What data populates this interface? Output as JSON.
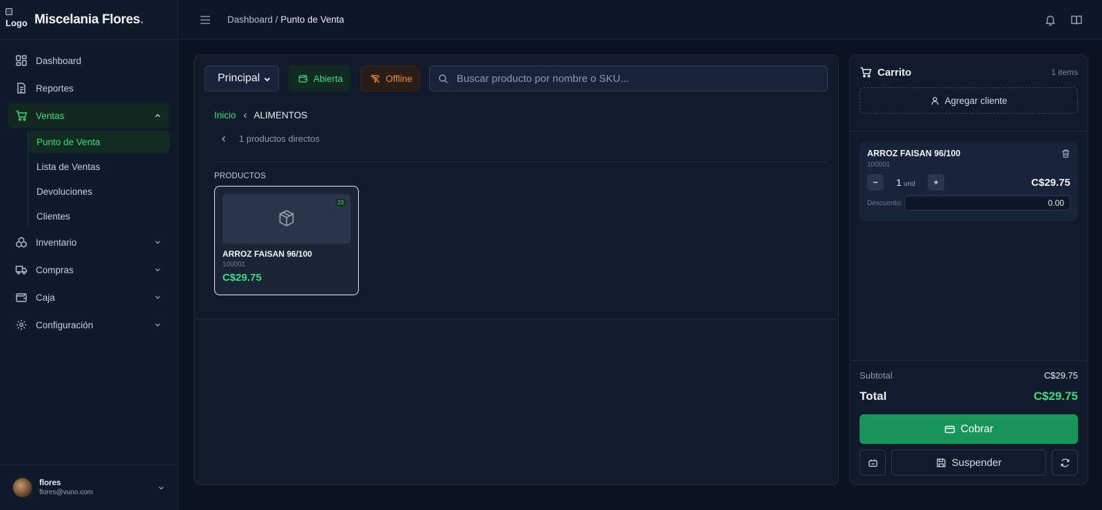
{
  "app": {
    "logo_alt": "Logo",
    "name": "Miscelania Flores",
    "name_dot": "."
  },
  "colors": {
    "accent": "#3ddc84",
    "background": "#0b1322",
    "panel": "#111b2c",
    "offline": "#f28a3a",
    "primary_button": "#17955a"
  },
  "sidebar": {
    "items": [
      {
        "label": "Dashboard",
        "icon": "dashboard-grid-icon"
      },
      {
        "label": "Reportes",
        "icon": "document-icon"
      },
      {
        "label": "Ventas",
        "icon": "shopping-cart-icon",
        "expanded": true
      },
      {
        "label": "Inventario",
        "icon": "boxes-icon"
      },
      {
        "label": "Compras",
        "icon": "truck-icon"
      },
      {
        "label": "Caja",
        "icon": "wallet-icon"
      },
      {
        "label": "Configuración",
        "icon": "gear-icon"
      }
    ],
    "ventas_sub": [
      {
        "label": "Punto de Venta",
        "active": true
      },
      {
        "label": "Lista de Ventas"
      },
      {
        "label": "Devoluciones"
      },
      {
        "label": "Clientes"
      }
    ],
    "user": {
      "name": "flores",
      "email": "flores@vuno.com"
    }
  },
  "topbar": {
    "breadcrumb_parent": "Dashboard",
    "breadcrumb_sep": " / ",
    "breadcrumb_current": "Punto de Venta"
  },
  "pos": {
    "warehouse_selected": "Principal",
    "register_status": "Abierta",
    "connection_status": "Offline",
    "search_placeholder": "Buscar producto por nombre o SKU...",
    "breadcrumb_home": "Inicio",
    "breadcrumb_category": "ALIMENTOS",
    "direct_products": "1 productos directos",
    "products_heading": "PRODUCTOS",
    "products": [
      {
        "name": "ARROZ FAISAN 96/100",
        "sku": "100001",
        "price": "C$29.75",
        "stock": "23"
      }
    ]
  },
  "cart": {
    "title": "Carrito",
    "count": "1 items",
    "add_client": "Agregar cliente",
    "lines": [
      {
        "name": "ARROZ FAISAN 96/100",
        "sku": "100001",
        "qty": "1",
        "unit": "und",
        "price": "C$29.75",
        "discount_label": "Descuento:",
        "discount": "0.00"
      }
    ],
    "subtotal_label": "Subtotal",
    "subtotal": "C$29.75",
    "total_label": "Total",
    "total": "C$29.75",
    "charge_label": "Cobrar",
    "suspend_label": "Suspender"
  }
}
